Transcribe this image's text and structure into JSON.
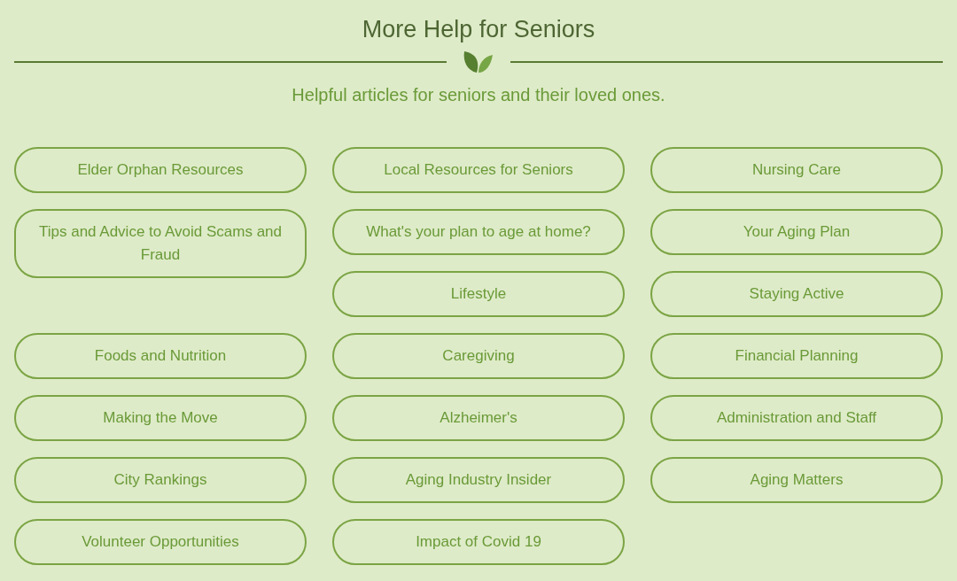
{
  "title": "More Help for Seniors",
  "subtitle": "Helpful articles for seniors and their loved ones.",
  "links": [
    {
      "label": "Elder Orphan Resources"
    },
    {
      "label": "Local Resources for Seniors"
    },
    {
      "label": "Nursing Care"
    },
    {
      "label": "Tips and Advice to Avoid Scams and Fraud"
    },
    {
      "label": "What's your plan to age at home?"
    },
    {
      "label": "Your Aging Plan"
    },
    {
      "label": "Lifestyle"
    },
    {
      "label": "Staying Active"
    },
    {
      "label": "Foods and Nutrition"
    },
    {
      "label": "Caregiving"
    },
    {
      "label": "Financial Planning"
    },
    {
      "label": "Making the Move"
    },
    {
      "label": "Alzheimer's"
    },
    {
      "label": "Administration and Staff"
    },
    {
      "label": "City Rankings"
    },
    {
      "label": "Aging Industry Insider"
    },
    {
      "label": "Aging Matters"
    },
    {
      "label": "Volunteer Opportunities"
    },
    {
      "label": "Impact of Covid 19"
    }
  ]
}
